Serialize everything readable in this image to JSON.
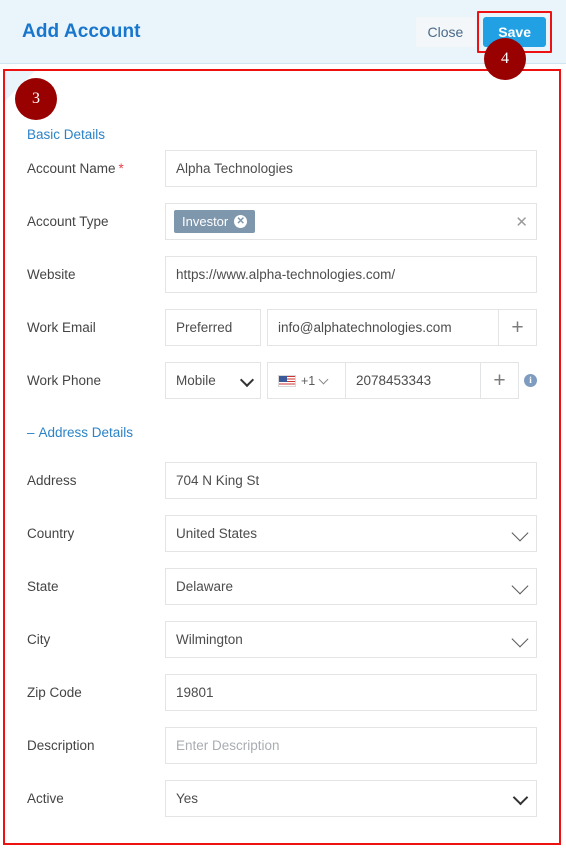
{
  "header": {
    "title": "Add Account",
    "close_label": "Close",
    "save_label": "Save",
    "bg_color": "#e9f4fb",
    "title_color": "#1876cd",
    "save_color": "#22a0e4"
  },
  "annotations": {
    "badge_color": "#990000",
    "outline_color": "#ee1111",
    "steps": [
      {
        "number": "3",
        "target": "form-panel"
      },
      {
        "number": "4",
        "target": "save-button"
      }
    ]
  },
  "sections": {
    "basic": {
      "title": "Basic Details"
    },
    "address": {
      "title": "Address Details",
      "collapse_glyph": "–"
    }
  },
  "fields": {
    "account_name": {
      "label": "Account Name",
      "required_marker": "*",
      "value": "Alpha Technologies"
    },
    "account_type": {
      "label": "Account Type",
      "tags": [
        {
          "text": "Investor",
          "remove_glyph": "✕"
        }
      ],
      "clear_glyph": "✕",
      "tag_color": "#7e97ad"
    },
    "website": {
      "label": "Website",
      "value": "https://www.alpha-technologies.com/"
    },
    "work_email": {
      "label": "Work Email",
      "preference": "Preferred",
      "value": "info@alphatechnologies.com",
      "add_glyph": "+"
    },
    "work_phone": {
      "label": "Work Phone",
      "type": "Mobile",
      "country_flag": "us-flag",
      "dial_code": "+1",
      "value": "2078453343",
      "add_glyph": "+",
      "info_glyph": "i"
    },
    "address": {
      "label": "Address",
      "value": "704 N King St"
    },
    "country": {
      "label": "Country",
      "value": "United States"
    },
    "state": {
      "label": "State",
      "value": "Delaware"
    },
    "city": {
      "label": "City",
      "value": "Wilmington"
    },
    "zip_code": {
      "label": "Zip Code",
      "value": "19801"
    },
    "description": {
      "label": "Description",
      "value": "",
      "placeholder": "Enter Description"
    },
    "active": {
      "label": "Active",
      "value": "Yes"
    }
  }
}
